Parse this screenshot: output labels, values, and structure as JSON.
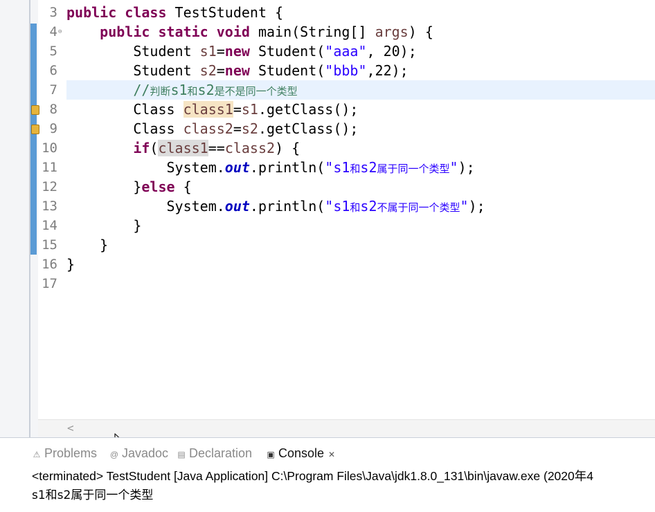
{
  "editor": {
    "lines": [
      {
        "num": "3",
        "tokens": [
          {
            "t": "public",
            "c": "kw"
          },
          {
            "t": " "
          },
          {
            "t": "class",
            "c": "kw"
          },
          {
            "t": " TestStudent {"
          }
        ]
      },
      {
        "num": "4",
        "fold": true,
        "tokens": [
          {
            "t": "    "
          },
          {
            "t": "public",
            "c": "kw"
          },
          {
            "t": " "
          },
          {
            "t": "static",
            "c": "kw"
          },
          {
            "t": " "
          },
          {
            "t": "void",
            "c": "kw"
          },
          {
            "t": " main(String[] "
          },
          {
            "t": "args",
            "c": "var"
          },
          {
            "t": ") {"
          }
        ]
      },
      {
        "num": "5",
        "tokens": [
          {
            "t": "        Student "
          },
          {
            "t": "s1",
            "c": "var"
          },
          {
            "t": "="
          },
          {
            "t": "new",
            "c": "kw"
          },
          {
            "t": " Student("
          },
          {
            "t": "\"aaa\"",
            "c": "str"
          },
          {
            "t": ", 20);"
          }
        ]
      },
      {
        "num": "6",
        "tokens": [
          {
            "t": "        Student "
          },
          {
            "t": "s2",
            "c": "var"
          },
          {
            "t": "="
          },
          {
            "t": "new",
            "c": "kw"
          },
          {
            "t": " Student("
          },
          {
            "t": "\"bbb\"",
            "c": "str"
          },
          {
            "t": ",22);"
          }
        ]
      },
      {
        "num": "7",
        "current": true,
        "tokens": [
          {
            "t": "        "
          },
          {
            "t": "//判断s1和s2是不是同一个类型",
            "c": "cm"
          }
        ]
      },
      {
        "num": "8",
        "marker": true,
        "tokens": [
          {
            "t": "        Class "
          },
          {
            "t": "class1",
            "c": "var occ-w"
          },
          {
            "t": "="
          },
          {
            "t": "s1",
            "c": "var"
          },
          {
            "t": ".getClass();"
          }
        ]
      },
      {
        "num": "9",
        "marker": true,
        "tokens": [
          {
            "t": "        Class "
          },
          {
            "t": "class2",
            "c": "var"
          },
          {
            "t": "="
          },
          {
            "t": "s2",
            "c": "var"
          },
          {
            "t": ".getClass();"
          }
        ]
      },
      {
        "num": "10",
        "tokens": [
          {
            "t": "        "
          },
          {
            "t": "if",
            "c": "kw"
          },
          {
            "t": "("
          },
          {
            "t": "class1",
            "c": "var occ-r"
          },
          {
            "t": "=="
          },
          {
            "t": "class2",
            "c": "var"
          },
          {
            "t": ") {"
          }
        ]
      },
      {
        "num": "11",
        "tokens": [
          {
            "t": "            System."
          },
          {
            "t": "out",
            "c": "fld"
          },
          {
            "t": ".println("
          },
          {
            "t": "\"s1和s2属于同一个类型\"",
            "c": "str"
          },
          {
            "t": ");"
          }
        ]
      },
      {
        "num": "12",
        "tokens": [
          {
            "t": "        }"
          },
          {
            "t": "else",
            "c": "kw"
          },
          {
            "t": " {"
          }
        ]
      },
      {
        "num": "13",
        "tokens": [
          {
            "t": "            System."
          },
          {
            "t": "out",
            "c": "fld"
          },
          {
            "t": ".println("
          },
          {
            "t": "\"s1和s2不属于同一个类型\"",
            "c": "str"
          },
          {
            "t": ");"
          }
        ]
      },
      {
        "num": "14",
        "tokens": [
          {
            "t": "        }"
          }
        ]
      },
      {
        "num": "15",
        "tokens": [
          {
            "t": "    }"
          }
        ]
      },
      {
        "num": "16",
        "tokens": [
          {
            "t": "}"
          }
        ]
      },
      {
        "num": "17",
        "tokens": []
      }
    ],
    "hscroll_left": "<"
  },
  "views": {
    "tabs": [
      {
        "label": "Problems",
        "icon": "problems-icon",
        "glyph": "⚠",
        "active": false
      },
      {
        "label": "Javadoc",
        "icon": "javadoc-icon",
        "glyph": "@",
        "active": false
      },
      {
        "label": "Declaration",
        "icon": "declaration-icon",
        "glyph": "▤",
        "active": false
      },
      {
        "label": "Console",
        "icon": "console-icon",
        "glyph": "▣",
        "active": true,
        "close": "✕"
      }
    ],
    "console": {
      "status": "<terminated> TestStudent [Java Application] C:\\Program Files\\Java\\jdk1.8.0_131\\bin\\javaw.exe (2020年4",
      "output": "s1和s2属于同一个类型"
    }
  },
  "colors": {
    "keyword": "#7f0055",
    "string": "#2a00ff",
    "comment": "#3f7f5f",
    "local_var": "#6a3e3e",
    "static_field": "#0000c0",
    "change_bar": "#5b9bd5"
  }
}
